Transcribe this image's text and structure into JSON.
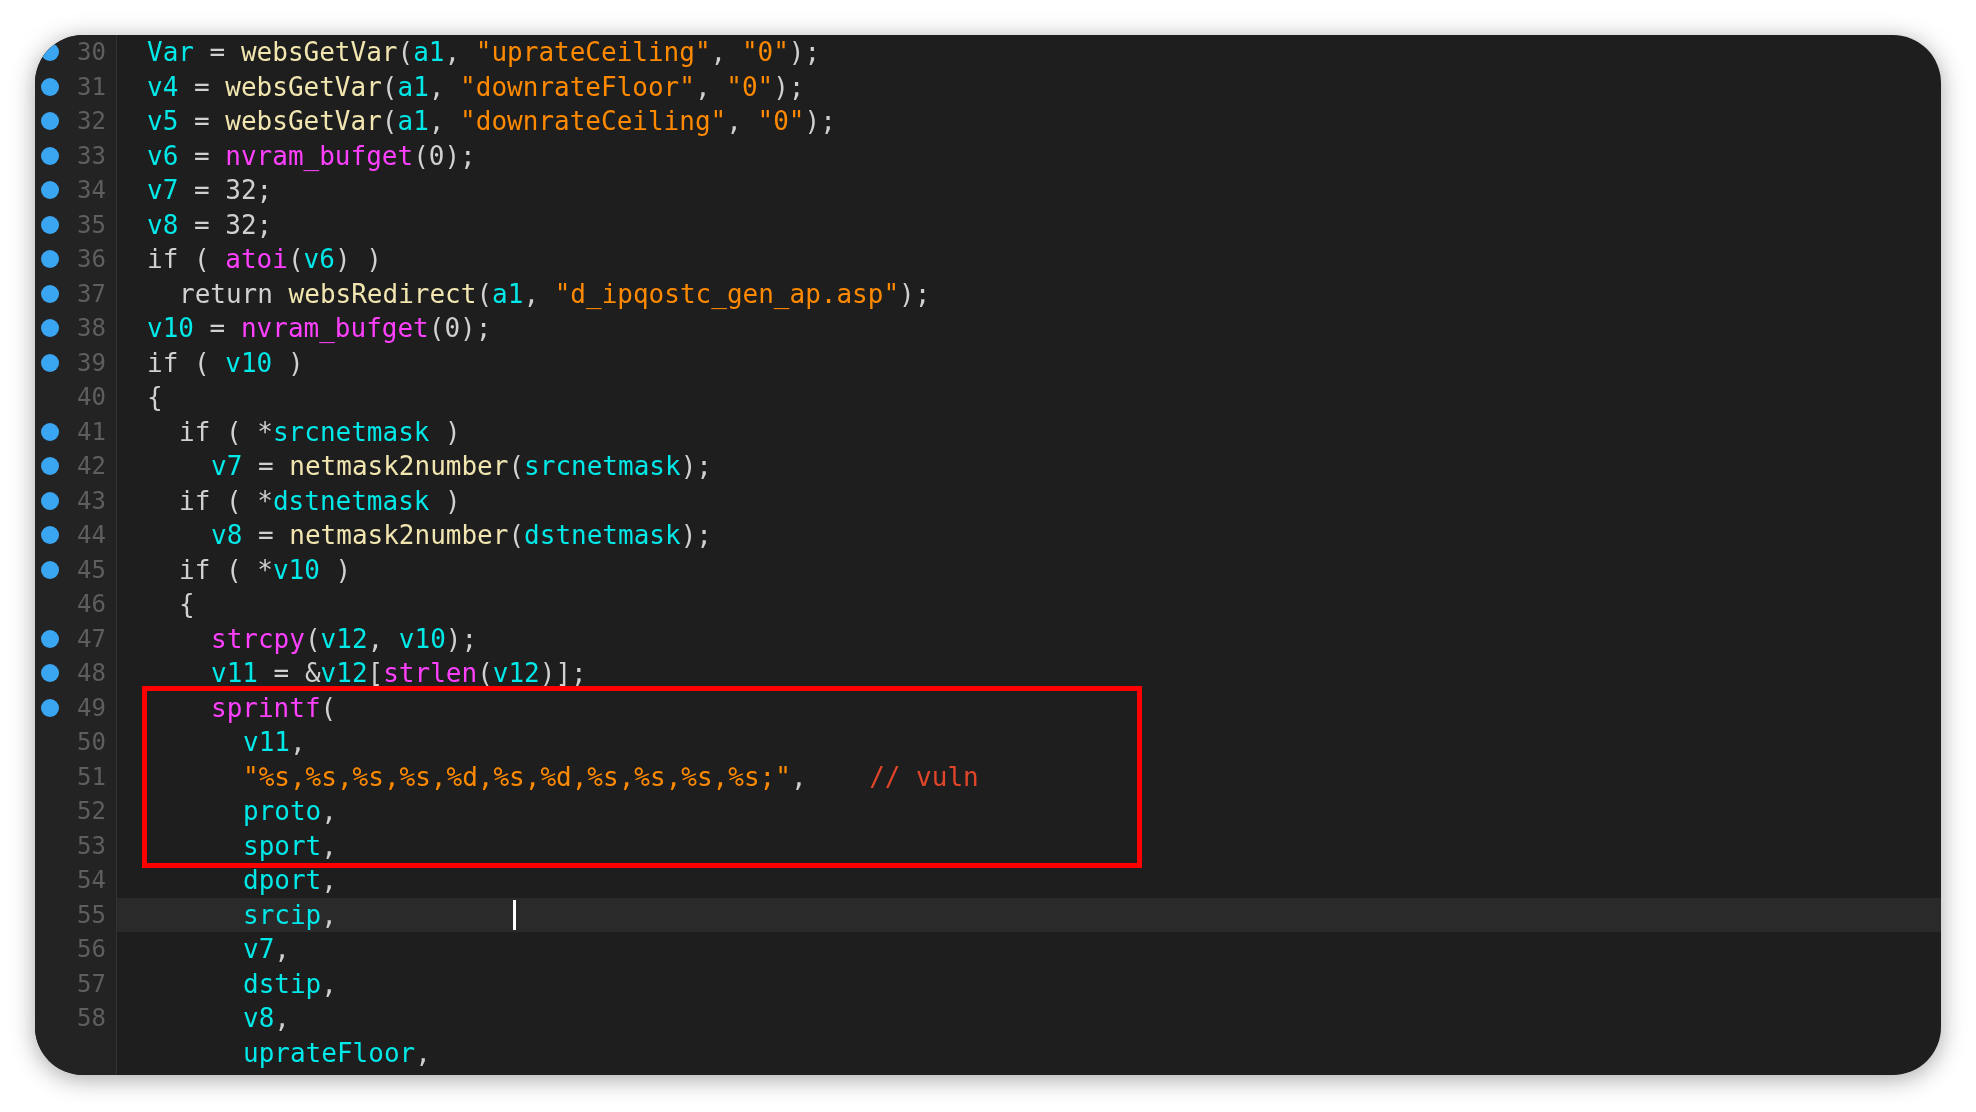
{
  "editor": {
    "lines": [
      {
        "number": "30",
        "breakpoint": true,
        "current": false,
        "boxed": false,
        "cursor": false,
        "tokens": [
          {
            "kind": "var",
            "text": "Var"
          },
          {
            "kind": "plain",
            "text": " = "
          },
          {
            "kind": "func",
            "text": "websGetVar"
          },
          {
            "kind": "plain",
            "text": "("
          },
          {
            "kind": "var",
            "text": "a1"
          },
          {
            "kind": "plain",
            "text": ", "
          },
          {
            "kind": "string",
            "text": "\"uprateCeiling\""
          },
          {
            "kind": "plain",
            "text": ", "
          },
          {
            "kind": "string",
            "text": "\"0\""
          },
          {
            "kind": "plain",
            "text": ");"
          }
        ]
      },
      {
        "number": "31",
        "breakpoint": true,
        "current": false,
        "boxed": false,
        "cursor": false,
        "tokens": [
          {
            "kind": "var",
            "text": "v4"
          },
          {
            "kind": "plain",
            "text": " = "
          },
          {
            "kind": "func",
            "text": "websGetVar"
          },
          {
            "kind": "plain",
            "text": "("
          },
          {
            "kind": "var",
            "text": "a1"
          },
          {
            "kind": "plain",
            "text": ", "
          },
          {
            "kind": "string",
            "text": "\"downrateFloor\""
          },
          {
            "kind": "plain",
            "text": ", "
          },
          {
            "kind": "string",
            "text": "\"0\""
          },
          {
            "kind": "plain",
            "text": ");"
          }
        ]
      },
      {
        "number": "32",
        "breakpoint": true,
        "current": false,
        "boxed": false,
        "cursor": false,
        "tokens": [
          {
            "kind": "var",
            "text": "v5"
          },
          {
            "kind": "plain",
            "text": " = "
          },
          {
            "kind": "func",
            "text": "websGetVar"
          },
          {
            "kind": "plain",
            "text": "("
          },
          {
            "kind": "var",
            "text": "a1"
          },
          {
            "kind": "plain",
            "text": ", "
          },
          {
            "kind": "string",
            "text": "\"downrateCeiling\""
          },
          {
            "kind": "plain",
            "text": ", "
          },
          {
            "kind": "string",
            "text": "\"0\""
          },
          {
            "kind": "plain",
            "text": ");"
          }
        ]
      },
      {
        "number": "33",
        "breakpoint": true,
        "current": false,
        "boxed": false,
        "cursor": false,
        "tokens": [
          {
            "kind": "var",
            "text": "v6"
          },
          {
            "kind": "plain",
            "text": " = "
          },
          {
            "kind": "import",
            "text": "nvram_bufget"
          },
          {
            "kind": "plain",
            "text": "(0);"
          }
        ]
      },
      {
        "number": "34",
        "breakpoint": true,
        "current": false,
        "boxed": false,
        "cursor": false,
        "tokens": [
          {
            "kind": "var",
            "text": "v7"
          },
          {
            "kind": "plain",
            "text": " = 32;"
          }
        ]
      },
      {
        "number": "35",
        "breakpoint": true,
        "current": false,
        "boxed": false,
        "cursor": false,
        "tokens": [
          {
            "kind": "var",
            "text": "v8"
          },
          {
            "kind": "plain",
            "text": " = 32;"
          }
        ]
      },
      {
        "number": "36",
        "breakpoint": true,
        "current": false,
        "boxed": false,
        "cursor": false,
        "tokens": [
          {
            "kind": "plain",
            "text": "if ( "
          },
          {
            "kind": "import",
            "text": "atoi"
          },
          {
            "kind": "plain",
            "text": "("
          },
          {
            "kind": "var",
            "text": "v6"
          },
          {
            "kind": "plain",
            "text": ") )"
          }
        ],
        "children": [
          {
            "number": "37",
            "breakpoint": true,
            "current": false,
            "boxed": false,
            "cursor": false,
            "tokens": [
              {
                "kind": "plain",
                "text": "return "
              },
              {
                "kind": "func",
                "text": "websRedirect"
              },
              {
                "kind": "plain",
                "text": "("
              },
              {
                "kind": "var",
                "text": "a1"
              },
              {
                "kind": "plain",
                "text": ", "
              },
              {
                "kind": "string",
                "text": "\"d_ipqostc_gen_ap.asp\""
              },
              {
                "kind": "plain",
                "text": ");"
              }
            ]
          }
        ]
      },
      {
        "number": "38",
        "breakpoint": true,
        "current": false,
        "boxed": false,
        "cursor": false,
        "tokens": [
          {
            "kind": "var",
            "text": "v10"
          },
          {
            "kind": "plain",
            "text": " = "
          },
          {
            "kind": "import",
            "text": "nvram_bufget"
          },
          {
            "kind": "plain",
            "text": "(0);"
          }
        ]
      },
      {
        "number": "39",
        "breakpoint": true,
        "current": false,
        "boxed": false,
        "cursor": false,
        "tokens": [
          {
            "kind": "plain",
            "text": "if ( "
          },
          {
            "kind": "var",
            "text": "v10"
          },
          {
            "kind": "plain",
            "text": " )"
          }
        ]
      },
      {
        "number": "40",
        "breakpoint": false,
        "current": false,
        "boxed": false,
        "cursor": false,
        "tokens": [
          {
            "kind": "plain",
            "text": "{"
          }
        ],
        "children": [
          {
            "number": "41",
            "breakpoint": true,
            "current": false,
            "boxed": false,
            "cursor": false,
            "tokens": [
              {
                "kind": "plain",
                "text": "if ( *"
              },
              {
                "kind": "var",
                "text": "srcnetmask"
              },
              {
                "kind": "plain",
                "text": " )"
              }
            ],
            "children": [
              {
                "number": "42",
                "breakpoint": true,
                "current": false,
                "boxed": false,
                "cursor": false,
                "tokens": [
                  {
                    "kind": "var",
                    "text": "v7"
                  },
                  {
                    "kind": "plain",
                    "text": " = "
                  },
                  {
                    "kind": "func",
                    "text": "netmask2number"
                  },
                  {
                    "kind": "plain",
                    "text": "("
                  },
                  {
                    "kind": "var",
                    "text": "srcnetmask"
                  },
                  {
                    "kind": "plain",
                    "text": ");"
                  }
                ]
              }
            ]
          },
          {
            "number": "43",
            "breakpoint": true,
            "current": false,
            "boxed": false,
            "cursor": false,
            "tokens": [
              {
                "kind": "plain",
                "text": "if ( *"
              },
              {
                "kind": "var",
                "text": "dstnetmask"
              },
              {
                "kind": "plain",
                "text": " )"
              }
            ],
            "children": [
              {
                "number": "44",
                "breakpoint": true,
                "current": false,
                "boxed": false,
                "cursor": false,
                "tokens": [
                  {
                    "kind": "var",
                    "text": "v8"
                  },
                  {
                    "kind": "plain",
                    "text": " = "
                  },
                  {
                    "kind": "func",
                    "text": "netmask2number"
                  },
                  {
                    "kind": "plain",
                    "text": "("
                  },
                  {
                    "kind": "var",
                    "text": "dstnetmask"
                  },
                  {
                    "kind": "plain",
                    "text": ");"
                  }
                ]
              }
            ]
          },
          {
            "number": "45",
            "breakpoint": true,
            "current": false,
            "boxed": false,
            "cursor": false,
            "tokens": [
              {
                "kind": "plain",
                "text": "if ( *"
              },
              {
                "kind": "var",
                "text": "v10"
              },
              {
                "kind": "plain",
                "text": " )"
              }
            ]
          },
          {
            "number": "46",
            "breakpoint": false,
            "current": false,
            "boxed": false,
            "cursor": false,
            "tokens": [
              {
                "kind": "plain",
                "text": "{"
              }
            ],
            "children": [
              {
                "number": "47",
                "breakpoint": true,
                "current": false,
                "boxed": false,
                "cursor": false,
                "tokens": [
                  {
                    "kind": "import",
                    "text": "strcpy"
                  },
                  {
                    "kind": "plain",
                    "text": "("
                  },
                  {
                    "kind": "var",
                    "text": "v12"
                  },
                  {
                    "kind": "plain",
                    "text": ", "
                  },
                  {
                    "kind": "var",
                    "text": "v10"
                  },
                  {
                    "kind": "plain",
                    "text": ");"
                  }
                ]
              },
              {
                "number": "48",
                "breakpoint": true,
                "current": false,
                "boxed": false,
                "cursor": false,
                "tokens": [
                  {
                    "kind": "var",
                    "text": "v11"
                  },
                  {
                    "kind": "plain",
                    "text": " = &"
                  },
                  {
                    "kind": "var",
                    "text": "v12"
                  },
                  {
                    "kind": "plain",
                    "text": "["
                  },
                  {
                    "kind": "import",
                    "text": "strlen"
                  },
                  {
                    "kind": "plain",
                    "text": "("
                  },
                  {
                    "kind": "var",
                    "text": "v12"
                  },
                  {
                    "kind": "plain",
                    "text": ")];"
                  }
                ]
              },
              {
                "number": "49",
                "breakpoint": true,
                "current": false,
                "boxed": true,
                "cursor": false,
                "tokens": [
                  {
                    "kind": "import",
                    "text": "sprintf"
                  },
                  {
                    "kind": "plain",
                    "text": "("
                  }
                ],
                "children": [
                  {
                    "number": "50",
                    "breakpoint": false,
                    "current": false,
                    "boxed": true,
                    "cursor": false,
                    "tokens": [
                      {
                        "kind": "var",
                        "text": "v11"
                      },
                      {
                        "kind": "plain",
                        "text": ","
                      }
                    ]
                  },
                  {
                    "number": "51",
                    "breakpoint": false,
                    "current": false,
                    "boxed": true,
                    "cursor": false,
                    "tokens": [
                      {
                        "kind": "string",
                        "text": "\"%s,%s,%s,%s,%d,%s,%d,%s,%s,%s,%s;\""
                      },
                      {
                        "kind": "plain",
                        "text": ",    "
                      },
                      {
                        "kind": "comment",
                        "text": "// vuln"
                      }
                    ]
                  },
                  {
                    "number": "52",
                    "breakpoint": false,
                    "current": false,
                    "boxed": true,
                    "cursor": false,
                    "tokens": [
                      {
                        "kind": "var",
                        "text": "proto"
                      },
                      {
                        "kind": "plain",
                        "text": ","
                      }
                    ]
                  },
                  {
                    "number": "53",
                    "breakpoint": false,
                    "current": false,
                    "boxed": true,
                    "cursor": false,
                    "tokens": [
                      {
                        "kind": "var",
                        "text": "sport"
                      },
                      {
                        "kind": "plain",
                        "text": ","
                      }
                    ]
                  },
                  {
                    "number": "54",
                    "breakpoint": false,
                    "current": false,
                    "boxed": false,
                    "cursor": false,
                    "tokens": [
                      {
                        "kind": "var",
                        "text": "dport"
                      },
                      {
                        "kind": "plain",
                        "text": ","
                      }
                    ]
                  },
                  {
                    "number": "55",
                    "breakpoint": false,
                    "current": true,
                    "boxed": false,
                    "cursor": true,
                    "tokens": [
                      {
                        "kind": "var",
                        "text": "srcip"
                      },
                      {
                        "kind": "plain",
                        "text": ","
                      }
                    ]
                  },
                  {
                    "number": "56",
                    "breakpoint": false,
                    "current": false,
                    "boxed": false,
                    "cursor": false,
                    "tokens": [
                      {
                        "kind": "var",
                        "text": "v7"
                      },
                      {
                        "kind": "plain",
                        "text": ","
                      }
                    ]
                  },
                  {
                    "number": "57",
                    "breakpoint": false,
                    "current": false,
                    "boxed": false,
                    "cursor": false,
                    "tokens": [
                      {
                        "kind": "var",
                        "text": "dstip"
                      },
                      {
                        "kind": "plain",
                        "text": ","
                      }
                    ]
                  },
                  {
                    "number": "58",
                    "breakpoint": false,
                    "current": false,
                    "boxed": false,
                    "cursor": false,
                    "tokens": [
                      {
                        "kind": "var",
                        "text": "v8"
                      },
                      {
                        "kind": "plain",
                        "text": ","
                      }
                    ]
                  },
                  {
                    "breakpoint": false,
                    "current": false,
                    "boxed": false,
                    "cursor": false,
                    "tokens": [
                      {
                        "kind": "var",
                        "text": "uprateFloor"
                      },
                      {
                        "kind": "plain",
                        "text": ","
                      }
                    ]
                  }
                ]
              }
            ]
          }
        ]
      }
    ]
  }
}
